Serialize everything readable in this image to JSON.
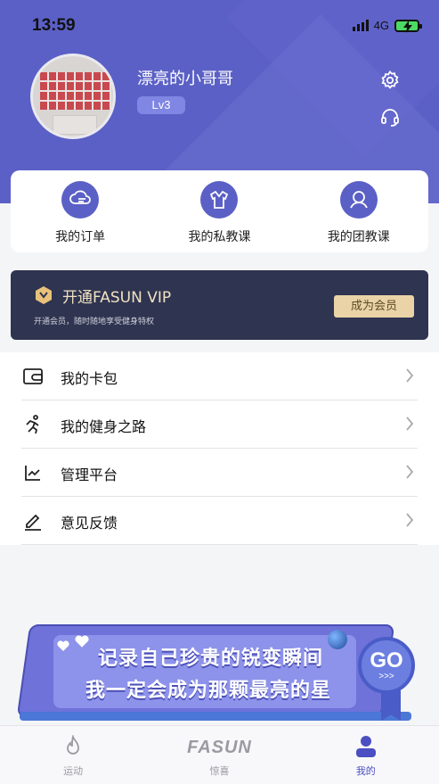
{
  "status_bar": {
    "time": "13:59",
    "network": "4G"
  },
  "profile": {
    "username": "漂亮的小哥哥",
    "level": "Lv3"
  },
  "quick_actions": [
    {
      "label": "我的订单",
      "icon": "order-icon"
    },
    {
      "label": "我的私教课",
      "icon": "private-coach-icon"
    },
    {
      "label": "我的团教课",
      "icon": "group-class-icon"
    }
  ],
  "vip": {
    "title": "开通FASUN VIP",
    "subtitle": "开通会员，随时随地享受健身特权",
    "button": "成为会员"
  },
  "menu": [
    {
      "label": "我的卡包",
      "icon": "wallet-icon"
    },
    {
      "label": "我的健身之路",
      "icon": "running-icon"
    },
    {
      "label": "管理平台",
      "icon": "chart-line-icon"
    },
    {
      "label": "意见反馈",
      "icon": "edit-icon"
    }
  ],
  "promo": {
    "line1": "记录自己珍贵的锐变瞬间",
    "line2": "我一定会成为那颗最亮的星",
    "badge": "GO",
    "badge_arrows": ">>>"
  },
  "tabbar": {
    "tabs": [
      {
        "label": "运动",
        "icon": "flame-icon",
        "active": false
      },
      {
        "label": "惊喜",
        "logo": "FASUN",
        "active": false
      },
      {
        "label": "我的",
        "icon": "person-icon",
        "active": true
      }
    ]
  },
  "colors": {
    "primary": "#5b60c6",
    "vip_bg": "#2f3450",
    "vip_gold": "#e9d3a7",
    "active_tab": "#4b4fc2"
  }
}
